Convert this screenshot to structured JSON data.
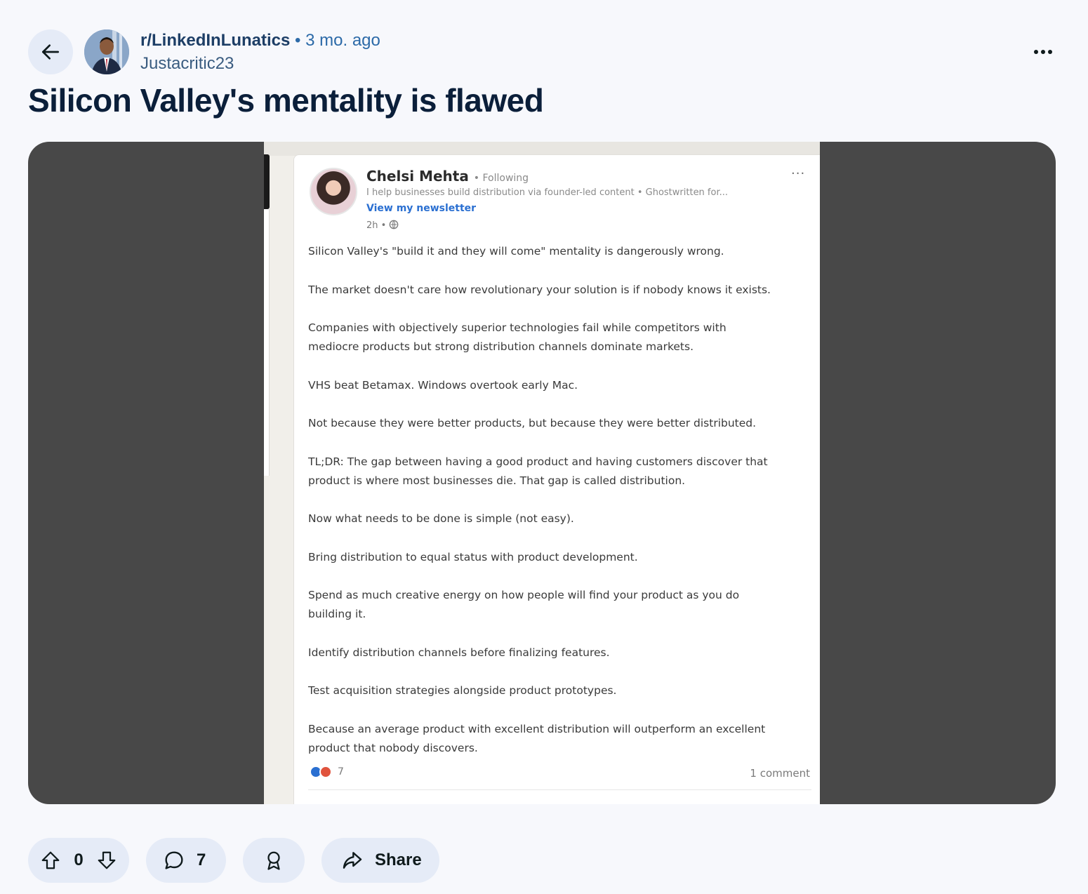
{
  "header": {
    "subreddit": "r/LinkedInLunatics",
    "separator": "•",
    "time_ago": "3 mo. ago",
    "username": "Justacritic23"
  },
  "post": {
    "title": "Silicon Valley's mentality is flawed"
  },
  "embedded_linkedin_post": {
    "author_name": "Chelsi Mehta",
    "connection_status": "• Following",
    "headline": "I help businesses build distribution via founder-led content • Ghostwritten for...",
    "newsletter_link": "View my newsletter",
    "time": "2h •",
    "more": "···",
    "paragraphs": [
      "Silicon Valley's \"build it and they will come\" mentality is dangerously wrong.",
      "The market doesn't care how revolutionary your solution is if nobody knows it exists.",
      "Companies with objectively superior technologies fail while competitors with\nmediocre products but strong distribution channels dominate markets.",
      "VHS beat Betamax. Windows overtook early Mac.",
      "Not because they were better products, but because they were better distributed.",
      "TL;DR: The gap between having a good product and having customers discover that\nproduct is where most businesses die. That gap is called distribution.",
      "Now what needs to be done is simple (not easy).",
      "Bring distribution to equal status with product development.",
      "Spend as much creative energy on how people will find your product as you do\nbuilding it.",
      "Identify distribution channels before finalizing features.",
      "Test acquisition strategies alongside product prototypes.",
      "Because an average product with excellent distribution will outperform an excellent\nproduct that nobody discovers."
    ],
    "reaction_count": "7",
    "comments": "1 comment",
    "reaction_icons": [
      "like-icon",
      "love-icon"
    ]
  },
  "actions": {
    "vote_count": "0",
    "comment_count": "7",
    "share_label": "Share"
  },
  "icons": {
    "back": "arrow-left-icon",
    "more": "more-horizontal-icon",
    "upvote": "arrow-up-icon",
    "downvote": "arrow-down-icon",
    "comment": "chat-bubble-icon",
    "award": "award-icon",
    "share": "share-arrow-icon"
  },
  "colors": {
    "page_bg": "#f7f8fc",
    "pill_bg": "#e5ebf7",
    "media_bg": "#484848",
    "subreddit": "#1d3e66",
    "link_blue": "#2a6fd1"
  }
}
